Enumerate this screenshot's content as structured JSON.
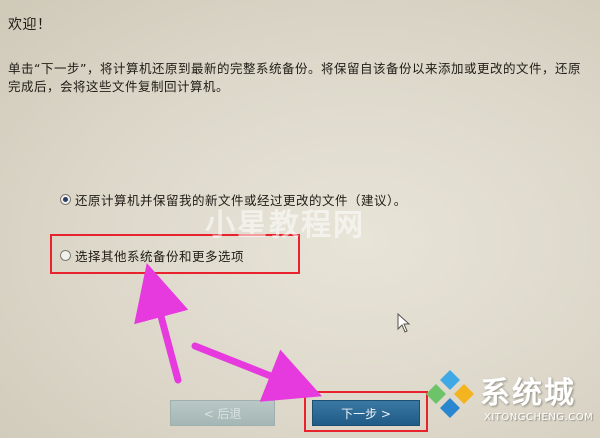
{
  "dialog": {
    "welcome": "欢迎！",
    "description": "单击“下一步”，将计算机还原到最新的完整系统备份。将保留自该备份以来添加或更改的文件，还原完成后，会将这些文件复制回计算机。",
    "options": [
      {
        "label": "还原计算机并保留我的新文件或经过更改的文件（建议）。",
        "selected": true
      },
      {
        "label": "选择其他系统备份和更多选项",
        "selected": false
      }
    ],
    "buttons": {
      "back": "< 后退",
      "next": "下一步 >"
    }
  },
  "watermarks": {
    "center": "小星教程网",
    "corner_name": "系统城",
    "corner_url": "XITONGCHENG.COM"
  },
  "colors": {
    "annotation_red": "#e8232e",
    "annotation_arrow": "#e63adf",
    "next_button": "#2a6694"
  }
}
